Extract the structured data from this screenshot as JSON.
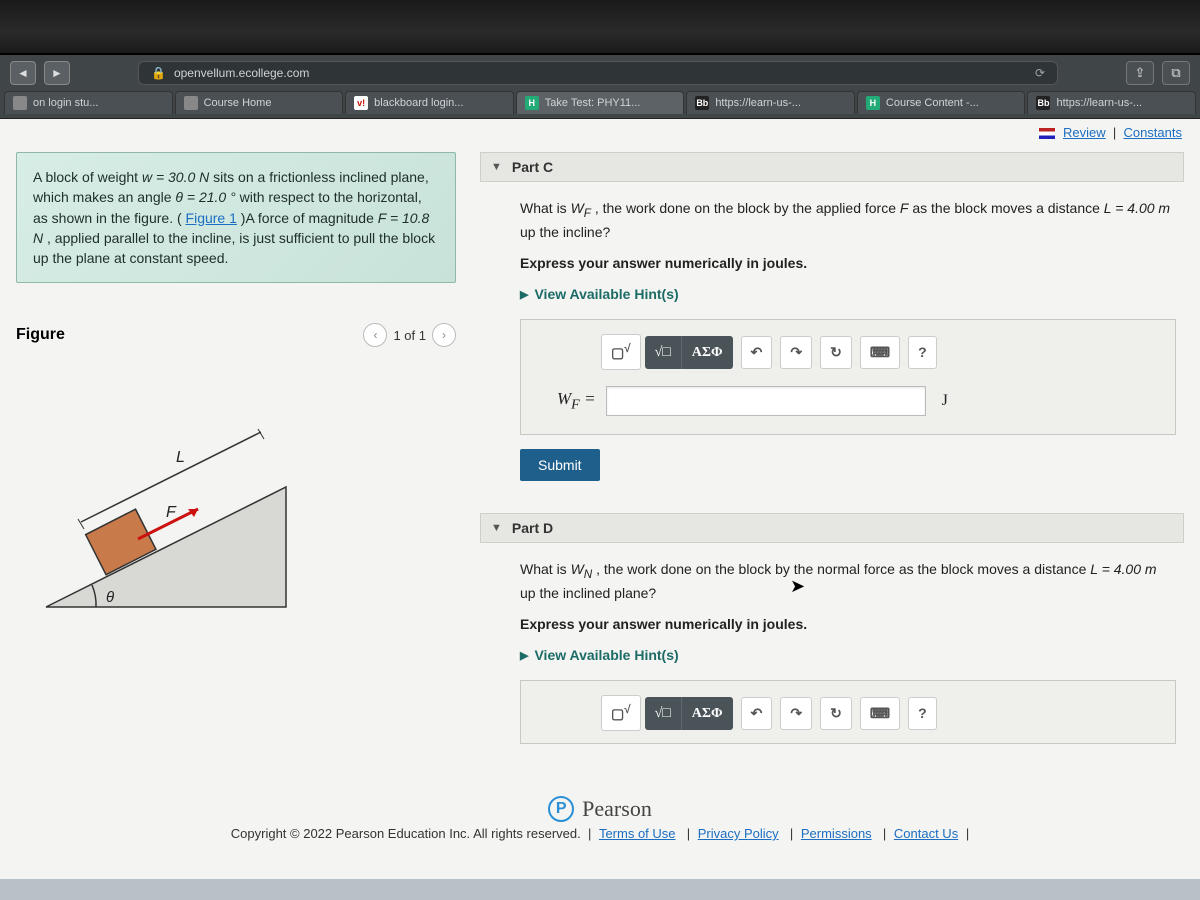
{
  "url": "openvellum.ecollege.com",
  "tabs": [
    {
      "label": "on login stu...",
      "icon": "box"
    },
    {
      "label": "Course Home",
      "icon": "box"
    },
    {
      "label": "blackboard login...",
      "icon": "v"
    },
    {
      "label": "Take Test: PHY11...",
      "icon": "hn"
    },
    {
      "label": "https://learn-us-...",
      "icon": "bb"
    },
    {
      "label": "Course Content -...",
      "icon": "hn"
    },
    {
      "label": "https://learn-us-...",
      "icon": "bb"
    }
  ],
  "top_links": {
    "review": "Review",
    "constants": "Constants"
  },
  "problem": {
    "text_pre": "A block of weight ",
    "w_expr": "w = 30.0 N",
    "text_mid1": " sits on a frictionless inclined plane, which makes an angle ",
    "theta_expr": "θ = 21.0 °",
    "text_mid2": " with respect to the horizontal, as shown in the figure. (",
    "figure_link": "Figure 1",
    "text_mid3": ")A force of magnitude ",
    "F_expr": "F = 10.8 N",
    "text_end": " , applied parallel to the incline, is just sufficient to pull the block up the plane at constant speed."
  },
  "figure": {
    "title": "Figure",
    "pager": "1 of 1",
    "L": "L",
    "F": "F",
    "theta": "θ"
  },
  "partC": {
    "title": "Part C",
    "q1": "What is ",
    "q_var": "W",
    "q_sub": "F",
    "q2": ", the work done on the block by the applied force ",
    "q_force": "F",
    "q3": " as the block moves a distance ",
    "q_L": "L = 4.00 m",
    "q4": " up the incline?",
    "instruct": "Express your answer numerically in joules.",
    "hints": "View Available Hint(s)",
    "ans_label_var": "W",
    "ans_label_sub": "F",
    "ans_eq": " = ",
    "unit": "J",
    "submit": "Submit"
  },
  "partD": {
    "title": "Part D",
    "q1": "What is ",
    "q_var": "W",
    "q_sub": "N",
    "q2": " , the work done on the block by the normal force as the block moves a distance ",
    "q_L": "L = 4.00 m",
    "q3": " up the inclined plane?",
    "instruct": "Express your answer numerically in joules.",
    "hints": "View Available Hint(s)"
  },
  "tools": {
    "templates": "√",
    "sigma": "ΑΣΦ",
    "undo": "↶",
    "redo": "↷",
    "reset": "↻",
    "keyboard": "⌨",
    "help": "?"
  },
  "pearson": "Pearson",
  "legal": {
    "copyright": "Copyright © 2022 Pearson Education Inc. All rights reserved.",
    "terms": "Terms of Use",
    "privacy": "Privacy Policy",
    "permissions": "Permissions",
    "contact": "Contact Us"
  }
}
